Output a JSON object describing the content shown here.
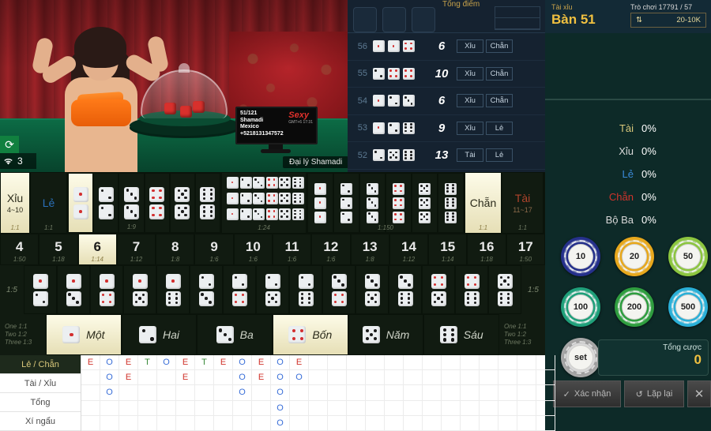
{
  "header": {
    "game_label": "Tài xỉu",
    "table_name": "Bàn 51",
    "game_number": "Trò chơi 17791 / 57",
    "limit_icon": "updown-arrow-icon",
    "limit": "20-10K"
  },
  "video": {
    "dealer_tag": "Đại lý Shamadi",
    "monitor": {
      "line1": "51/121",
      "line2": "Shamadi",
      "line3": "Mexico",
      "line4": "+5218131347572",
      "logo": "Sexy",
      "logo_sub": "GMT+6 17:31"
    },
    "refresh_icon": "refresh-icon",
    "wifi_icon": "wifi-icon",
    "wifi_level": "3",
    "live_dice": [
      1,
      4,
      1
    ]
  },
  "history": {
    "total_header": "Tổng điểm",
    "rows": [
      {
        "index": "56",
        "dice": [
          1,
          1,
          4
        ],
        "sum": "6",
        "tags": [
          "Xỉu",
          "Chẵn"
        ]
      },
      {
        "index": "55",
        "dice": [
          2,
          4,
          4
        ],
        "sum": "10",
        "tags": [
          "Xỉu",
          "Chẵn"
        ]
      },
      {
        "index": "54",
        "dice": [
          1,
          2,
          3
        ],
        "sum": "6",
        "tags": [
          "Xỉu",
          "Chẵn"
        ]
      },
      {
        "index": "53",
        "dice": [
          1,
          2,
          6
        ],
        "sum": "9",
        "tags": [
          "Xỉu",
          "Lẻ"
        ]
      },
      {
        "index": "52",
        "dice": [
          2,
          5,
          6
        ],
        "sum": "13",
        "tags": [
          "Tài",
          "Lẻ"
        ]
      }
    ]
  },
  "stats": {
    "rows": [
      {
        "label": "Tài",
        "value": "0%",
        "color": "#d8c77a"
      },
      {
        "label": "Xỉu",
        "value": "0%",
        "color": "#d8d8d8"
      },
      {
        "label": "Lẻ",
        "value": "0%",
        "color": "#3a8ad8"
      },
      {
        "label": "Chẵn",
        "value": "0%",
        "color": "#d0342c"
      },
      {
        "label": "Bộ Ba",
        "value": "0%",
        "color": "#d8d8d8"
      }
    ]
  },
  "chips": {
    "items": [
      {
        "value": "10",
        "color": "#25308c"
      },
      {
        "value": "20",
        "color": "#e8a81c"
      },
      {
        "value": "50",
        "color": "#8cc63f"
      },
      {
        "value": "100",
        "color": "#1fa07a"
      },
      {
        "value": "200",
        "color": "#2f9e3f"
      },
      {
        "value": "500",
        "color": "#2ab0d8"
      }
    ],
    "set_label": "set",
    "set_color": "#c8c8c8"
  },
  "total_bet": {
    "label": "Tổng cược",
    "value": "0"
  },
  "actions": {
    "confirm": "Xác nhận",
    "confirm_icon": "check-icon",
    "repeat": "Lặp lại",
    "repeat_icon": "refresh-icon",
    "close_icon": "close-icon"
  },
  "board": {
    "row1": {
      "left_big": {
        "name": "Xỉu",
        "range": "4~10",
        "odds": "1:1",
        "highlight": true
      },
      "left_odd": {
        "name": "Lẻ",
        "odds": "1:1",
        "highlight": false
      },
      "right_even": {
        "name": "Chẵn",
        "odds": "1:1",
        "highlight": true
      },
      "right_big": {
        "name": "Tài",
        "range": "11~17",
        "odds": "1:1",
        "highlight": false
      },
      "pairs_odds": "1:9",
      "pairs": [
        1,
        2,
        3,
        4,
        5,
        6
      ],
      "pairs_highlight": [
        true,
        false,
        false,
        false,
        false,
        false
      ],
      "anytriple_odds": "1:24",
      "triples_odds": "1:150",
      "triples": [
        1,
        2,
        3,
        4,
        5,
        6
      ]
    },
    "row2": {
      "numbers": [
        "4",
        "5",
        "6",
        "7",
        "8",
        "9",
        "10",
        "11",
        "12",
        "13",
        "14",
        "15",
        "16",
        "17"
      ],
      "odds": [
        "1:50",
        "1:18",
        "1:14",
        "1:12",
        "1:8",
        "1:6",
        "1:6",
        "1:6",
        "1:6",
        "1:8",
        "1:12",
        "1:14",
        "1:18",
        "1:50"
      ],
      "highlight_index": 2
    },
    "row3": {
      "left_odds": "1:5",
      "right_odds": "1:5",
      "combos": [
        [
          1,
          2
        ],
        [
          1,
          3
        ],
        [
          1,
          4
        ],
        [
          1,
          5
        ],
        [
          1,
          6
        ],
        [
          2,
          3
        ],
        [
          2,
          4
        ],
        [
          2,
          5
        ],
        [
          2,
          6
        ],
        [
          3,
          4
        ],
        [
          3,
          5
        ],
        [
          3,
          6
        ],
        [
          4,
          5
        ],
        [
          4,
          6
        ],
        [
          5,
          6
        ]
      ]
    },
    "row4": {
      "odds_lines": [
        "One 1:1",
        "Two 1:2",
        "Three 1:3"
      ],
      "items": [
        {
          "face": 1,
          "label": "Một",
          "highlight": true
        },
        {
          "face": 2,
          "label": "Hai",
          "highlight": false
        },
        {
          "face": 3,
          "label": "Ba",
          "highlight": false
        },
        {
          "face": 4,
          "label": "Bốn",
          "highlight": true
        },
        {
          "face": 5,
          "label": "Năm",
          "highlight": false
        },
        {
          "face": 6,
          "label": "Sáu",
          "highlight": false
        }
      ]
    }
  },
  "roadmap": {
    "tabs": [
      {
        "label": "Lẻ / Chẵn",
        "active": true
      },
      {
        "label": "Tài / Xỉu",
        "active": false
      },
      {
        "label": "Tổng",
        "active": false
      },
      {
        "label": "Xí ngẩu",
        "active": false
      }
    ],
    "columns": [
      [
        "E"
      ],
      [
        "O",
        "O",
        "O"
      ],
      [
        "E",
        "E"
      ],
      [
        "T"
      ],
      [
        "O"
      ],
      [
        "E",
        "E"
      ],
      [
        "T"
      ],
      [
        "E"
      ],
      [
        "O",
        "O",
        "O"
      ],
      [
        "E",
        "E"
      ],
      [
        "O",
        "O",
        "O",
        "O",
        "O"
      ],
      [
        "E",
        "O"
      ]
    ]
  }
}
